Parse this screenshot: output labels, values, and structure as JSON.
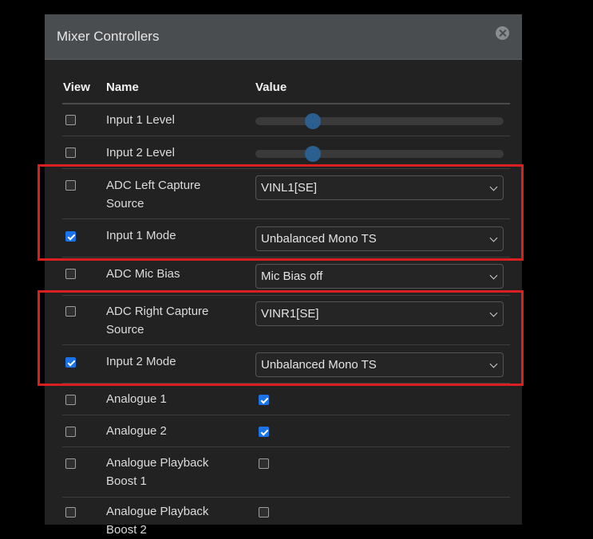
{
  "dialog": {
    "title": "Mixer Controllers",
    "close_icon": "close-icon"
  },
  "columns": {
    "view": "View",
    "name": "Name",
    "value": "Value"
  },
  "rows": [
    {
      "name": "Input 1 Level",
      "view_checked": false,
      "control": "slider",
      "slider_level": 0.23
    },
    {
      "name": "Input 2 Level",
      "view_checked": false,
      "control": "slider",
      "slider_level": 0.23
    },
    {
      "name": "ADC Left Capture Source",
      "view_checked": false,
      "control": "select",
      "selected": "VINL1[SE]"
    },
    {
      "name": "Input 1 Mode",
      "view_checked": true,
      "control": "select",
      "selected": "Unbalanced Mono TS"
    },
    {
      "name": "ADC Mic Bias",
      "view_checked": false,
      "control": "select",
      "selected": "Mic Bias off"
    },
    {
      "name": "ADC Right Capture Source",
      "view_checked": false,
      "control": "select",
      "selected": "VINR1[SE]"
    },
    {
      "name": "Input 2 Mode",
      "view_checked": true,
      "control": "select",
      "selected": "Unbalanced Mono TS"
    },
    {
      "name": "Analogue 1",
      "view_checked": false,
      "control": "checkbox",
      "value_checked": true
    },
    {
      "name": "Analogue 2",
      "view_checked": false,
      "control": "checkbox",
      "value_checked": true
    },
    {
      "name": "Analogue Playback Boost 1",
      "view_checked": false,
      "control": "checkbox",
      "value_checked": false
    },
    {
      "name": "Analogue Playback Boost 2",
      "view_checked": false,
      "control": "checkbox",
      "value_checked": false
    }
  ],
  "highlight_color": "#d91f1f",
  "accent_color": "#1a73e8"
}
